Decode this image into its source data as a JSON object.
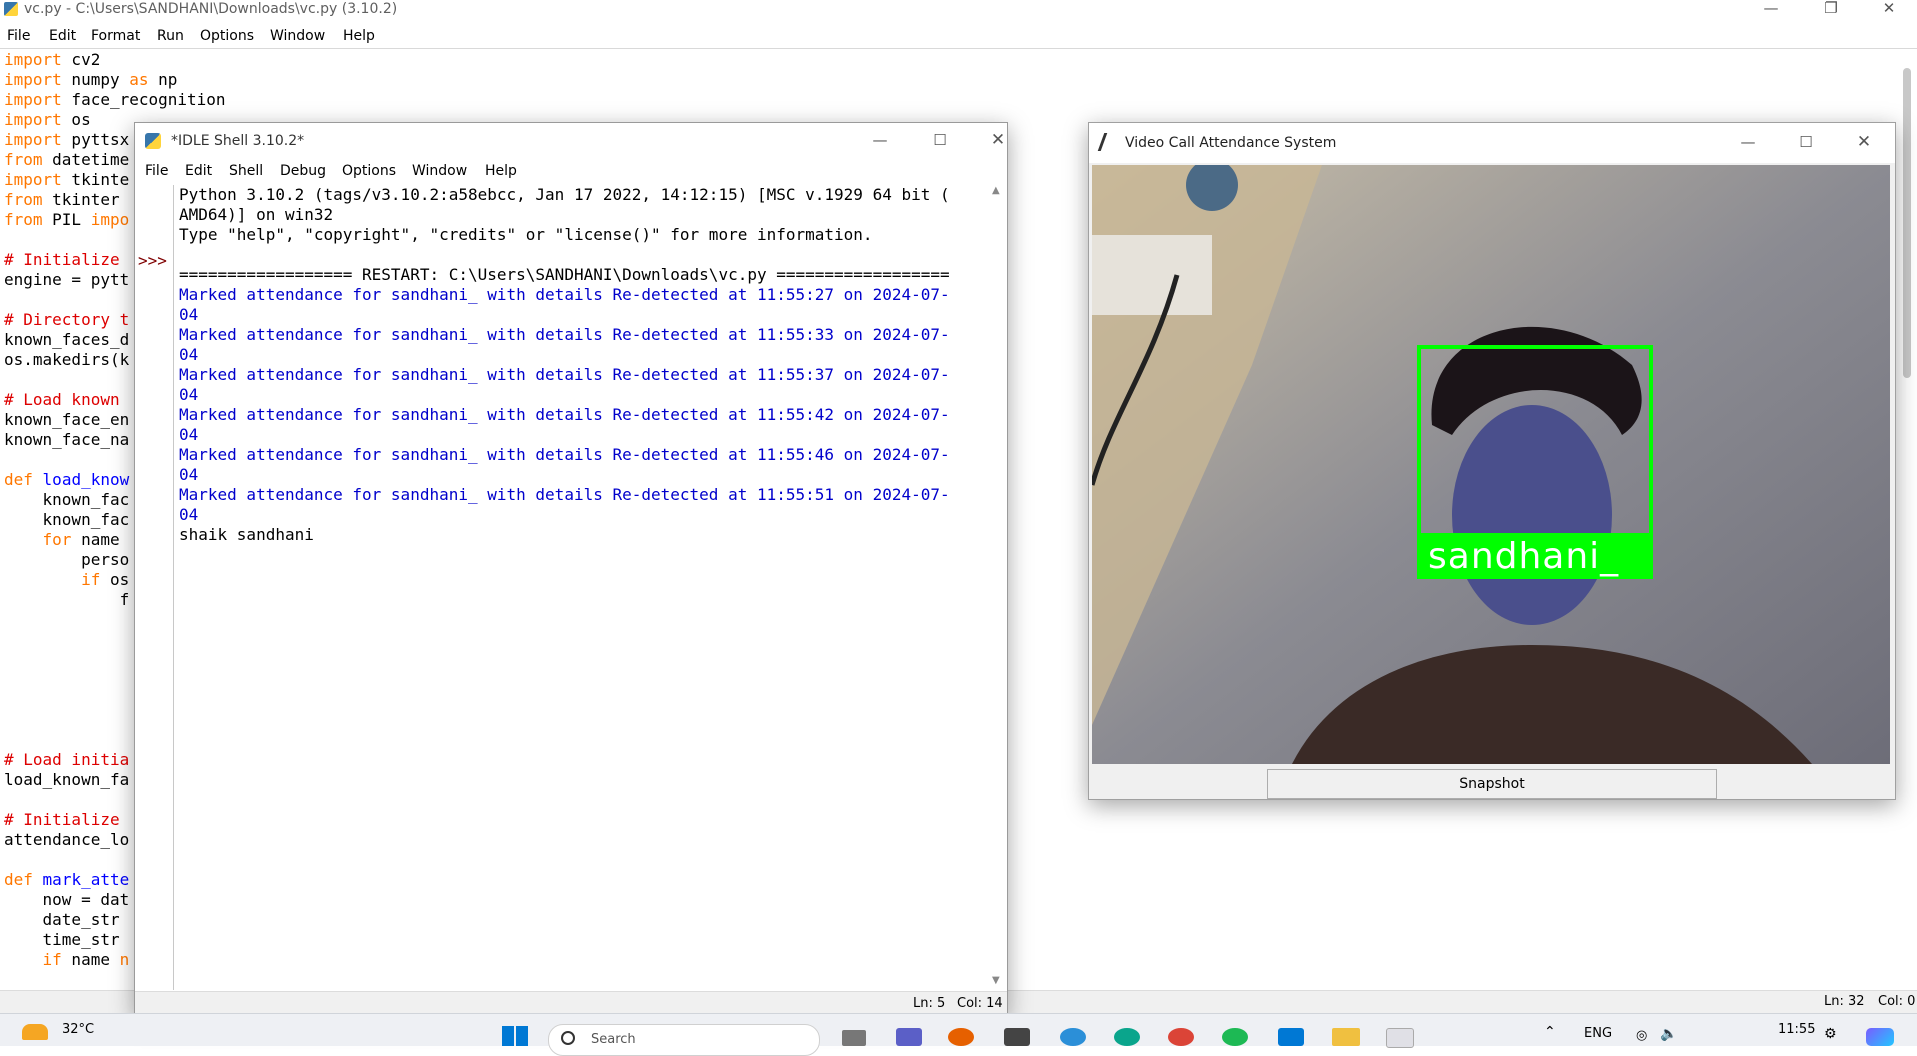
{
  "editor": {
    "title": "vc.py - C:\\Users\\SANDHANI\\Downloads\\vc.py (3.10.2)",
    "menu": [
      "File",
      "Edit",
      "Format",
      "Run",
      "Options",
      "Window",
      "Help"
    ],
    "code_lines": [
      [
        {
          "t": "import",
          "c": "kw"
        },
        {
          "t": " cv2"
        }
      ],
      [
        {
          "t": "import",
          "c": "kw"
        },
        {
          "t": " numpy "
        },
        {
          "t": "as",
          "c": "kw"
        },
        {
          "t": " np"
        }
      ],
      [
        {
          "t": "import",
          "c": "kw"
        },
        {
          "t": " face_recognition"
        }
      ],
      [
        {
          "t": "import",
          "c": "kw"
        },
        {
          "t": " os"
        }
      ],
      [
        {
          "t": "import",
          "c": "kw"
        },
        {
          "t": " pyttsx"
        }
      ],
      [
        {
          "t": "from",
          "c": "kw"
        },
        {
          "t": " datetime"
        }
      ],
      [
        {
          "t": "import",
          "c": "kw"
        },
        {
          "t": " tkinte"
        }
      ],
      [
        {
          "t": "from",
          "c": "kw"
        },
        {
          "t": " tkinter"
        }
      ],
      [
        {
          "t": "from",
          "c": "kw"
        },
        {
          "t": " PIL "
        },
        {
          "t": "impo",
          "c": "kw"
        }
      ],
      [],
      [
        {
          "t": "# Initialize",
          "c": "cm"
        }
      ],
      [
        {
          "t": "engine = pytt"
        }
      ],
      [],
      [
        {
          "t": "# Directory t",
          "c": "cm"
        }
      ],
      [
        {
          "t": "known_faces_d"
        }
      ],
      [
        {
          "t": "os.makedirs(k"
        }
      ],
      [],
      [
        {
          "t": "# Load known",
          "c": "cm"
        }
      ],
      [
        {
          "t": "known_face_en"
        }
      ],
      [
        {
          "t": "known_face_na"
        }
      ],
      [],
      [
        {
          "t": "def",
          "c": "kw"
        },
        {
          "t": " "
        },
        {
          "t": "load_know",
          "c": "df"
        }
      ],
      [
        {
          "t": "    known_fac"
        }
      ],
      [
        {
          "t": "    known_fac"
        }
      ],
      [
        {
          "t": "    "
        },
        {
          "t": "for",
          "c": "kw"
        },
        {
          "t": " name"
        }
      ],
      [
        {
          "t": "        perso"
        }
      ],
      [
        {
          "t": "        "
        },
        {
          "t": "if",
          "c": "kw"
        },
        {
          "t": " os"
        }
      ],
      [
        {
          "t": "            f"
        }
      ],
      [],
      [],
      [],
      [],
      [],
      [],
      [],
      [
        {
          "t": "# Load initia",
          "c": "cm"
        }
      ],
      [
        {
          "t": "load_known_fa"
        }
      ],
      [],
      [
        {
          "t": "# Initialize",
          "c": "cm"
        }
      ],
      [
        {
          "t": "attendance_lo"
        }
      ],
      [],
      [
        {
          "t": "def",
          "c": "kw"
        },
        {
          "t": " "
        },
        {
          "t": "mark_atte",
          "c": "df"
        }
      ],
      [
        {
          "t": "    now = dat"
        }
      ],
      [
        {
          "t": "    date_str"
        }
      ],
      [
        {
          "t": "    time_str"
        }
      ],
      [
        {
          "t": "    "
        },
        {
          "t": "if",
          "c": "kw"
        },
        {
          "t": " name "
        },
        {
          "t": "n",
          "c": "kw"
        }
      ]
    ],
    "status": {
      "ln": "Ln: 32",
      "col": "Col: 0"
    }
  },
  "shell": {
    "title": "*IDLE Shell 3.10.2*",
    "menu": [
      "File",
      "Edit",
      "Shell",
      "Debug",
      "Options",
      "Window",
      "Help"
    ],
    "prompt": ">>>",
    "lines": [
      {
        "t": "Python 3.10.2 (tags/v3.10.2:a58ebcc, Jan 17 2022, 14:12:15) [MSC v.1929 64 bit (",
        "c": ""
      },
      {
        "t": "AMD64)] on win32",
        "c": ""
      },
      {
        "t": "Type \"help\", \"copyright\", \"credits\" or \"license()\" for more information.",
        "c": ""
      },
      {
        "t": "",
        "c": ""
      },
      {
        "t": "================== RESTART: C:\\Users\\SANDHANI\\Downloads\\vc.py ==================",
        "c": ""
      },
      {
        "t": "Marked attendance for sandhani_ with details Re-detected at 11:55:27 on 2024-07-",
        "c": "out"
      },
      {
        "t": "04",
        "c": "out"
      },
      {
        "t": "Marked attendance for sandhani_ with details Re-detected at 11:55:33 on 2024-07-",
        "c": "out"
      },
      {
        "t": "04",
        "c": "out"
      },
      {
        "t": "Marked attendance for sandhani_ with details Re-detected at 11:55:37 on 2024-07-",
        "c": "out"
      },
      {
        "t": "04",
        "c": "out"
      },
      {
        "t": "Marked attendance for sandhani_ with details Re-detected at 11:55:42 on 2024-07-",
        "c": "out"
      },
      {
        "t": "04",
        "c": "out"
      },
      {
        "t": "Marked attendance for sandhani_ with details Re-detected at 11:55:46 on 2024-07-",
        "c": "out"
      },
      {
        "t": "04",
        "c": "out"
      },
      {
        "t": "Marked attendance for sandhani_ with details Re-detected at 11:55:51 on 2024-07-",
        "c": "out"
      },
      {
        "t": "04",
        "c": "out"
      },
      {
        "t": "shaik sandhani",
        "c": ""
      }
    ],
    "status": {
      "ln": "Ln: 5",
      "col": "Col: 14"
    }
  },
  "video": {
    "title": "Video Call Attendance System",
    "face_label": "sandhani_",
    "snapshot_label": "Snapshot",
    "box_color": "#00ff00"
  },
  "taskbar": {
    "weather": "32°C",
    "search_placeholder": "Search",
    "language": "ENG",
    "time": "11:55"
  },
  "colors": {
    "keyword": "#ff7700",
    "comment": "#dd0000",
    "def": "#0000ff",
    "shell_output": "#0000cc"
  }
}
